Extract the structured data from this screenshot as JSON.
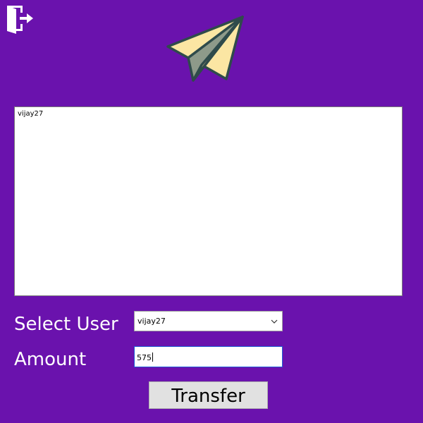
{
  "colors": {
    "background": "#6a12ad",
    "label_text": "#ffffff",
    "plane_light": "#fbe6a3",
    "plane_shade": "#e1c58b",
    "plane_tail": "#8e9a8a",
    "plane_outline": "#2f4b4b"
  },
  "header": {
    "logout_icon": "logout-icon",
    "logo_icon": "paper-plane-icon"
  },
  "user_list": {
    "items": [
      "vijay27"
    ]
  },
  "form": {
    "select_user_label": "Select User",
    "selected_user": "vijay27",
    "amount_label": "Amount",
    "amount_value": "575"
  },
  "actions": {
    "transfer_label": "Transfer"
  }
}
